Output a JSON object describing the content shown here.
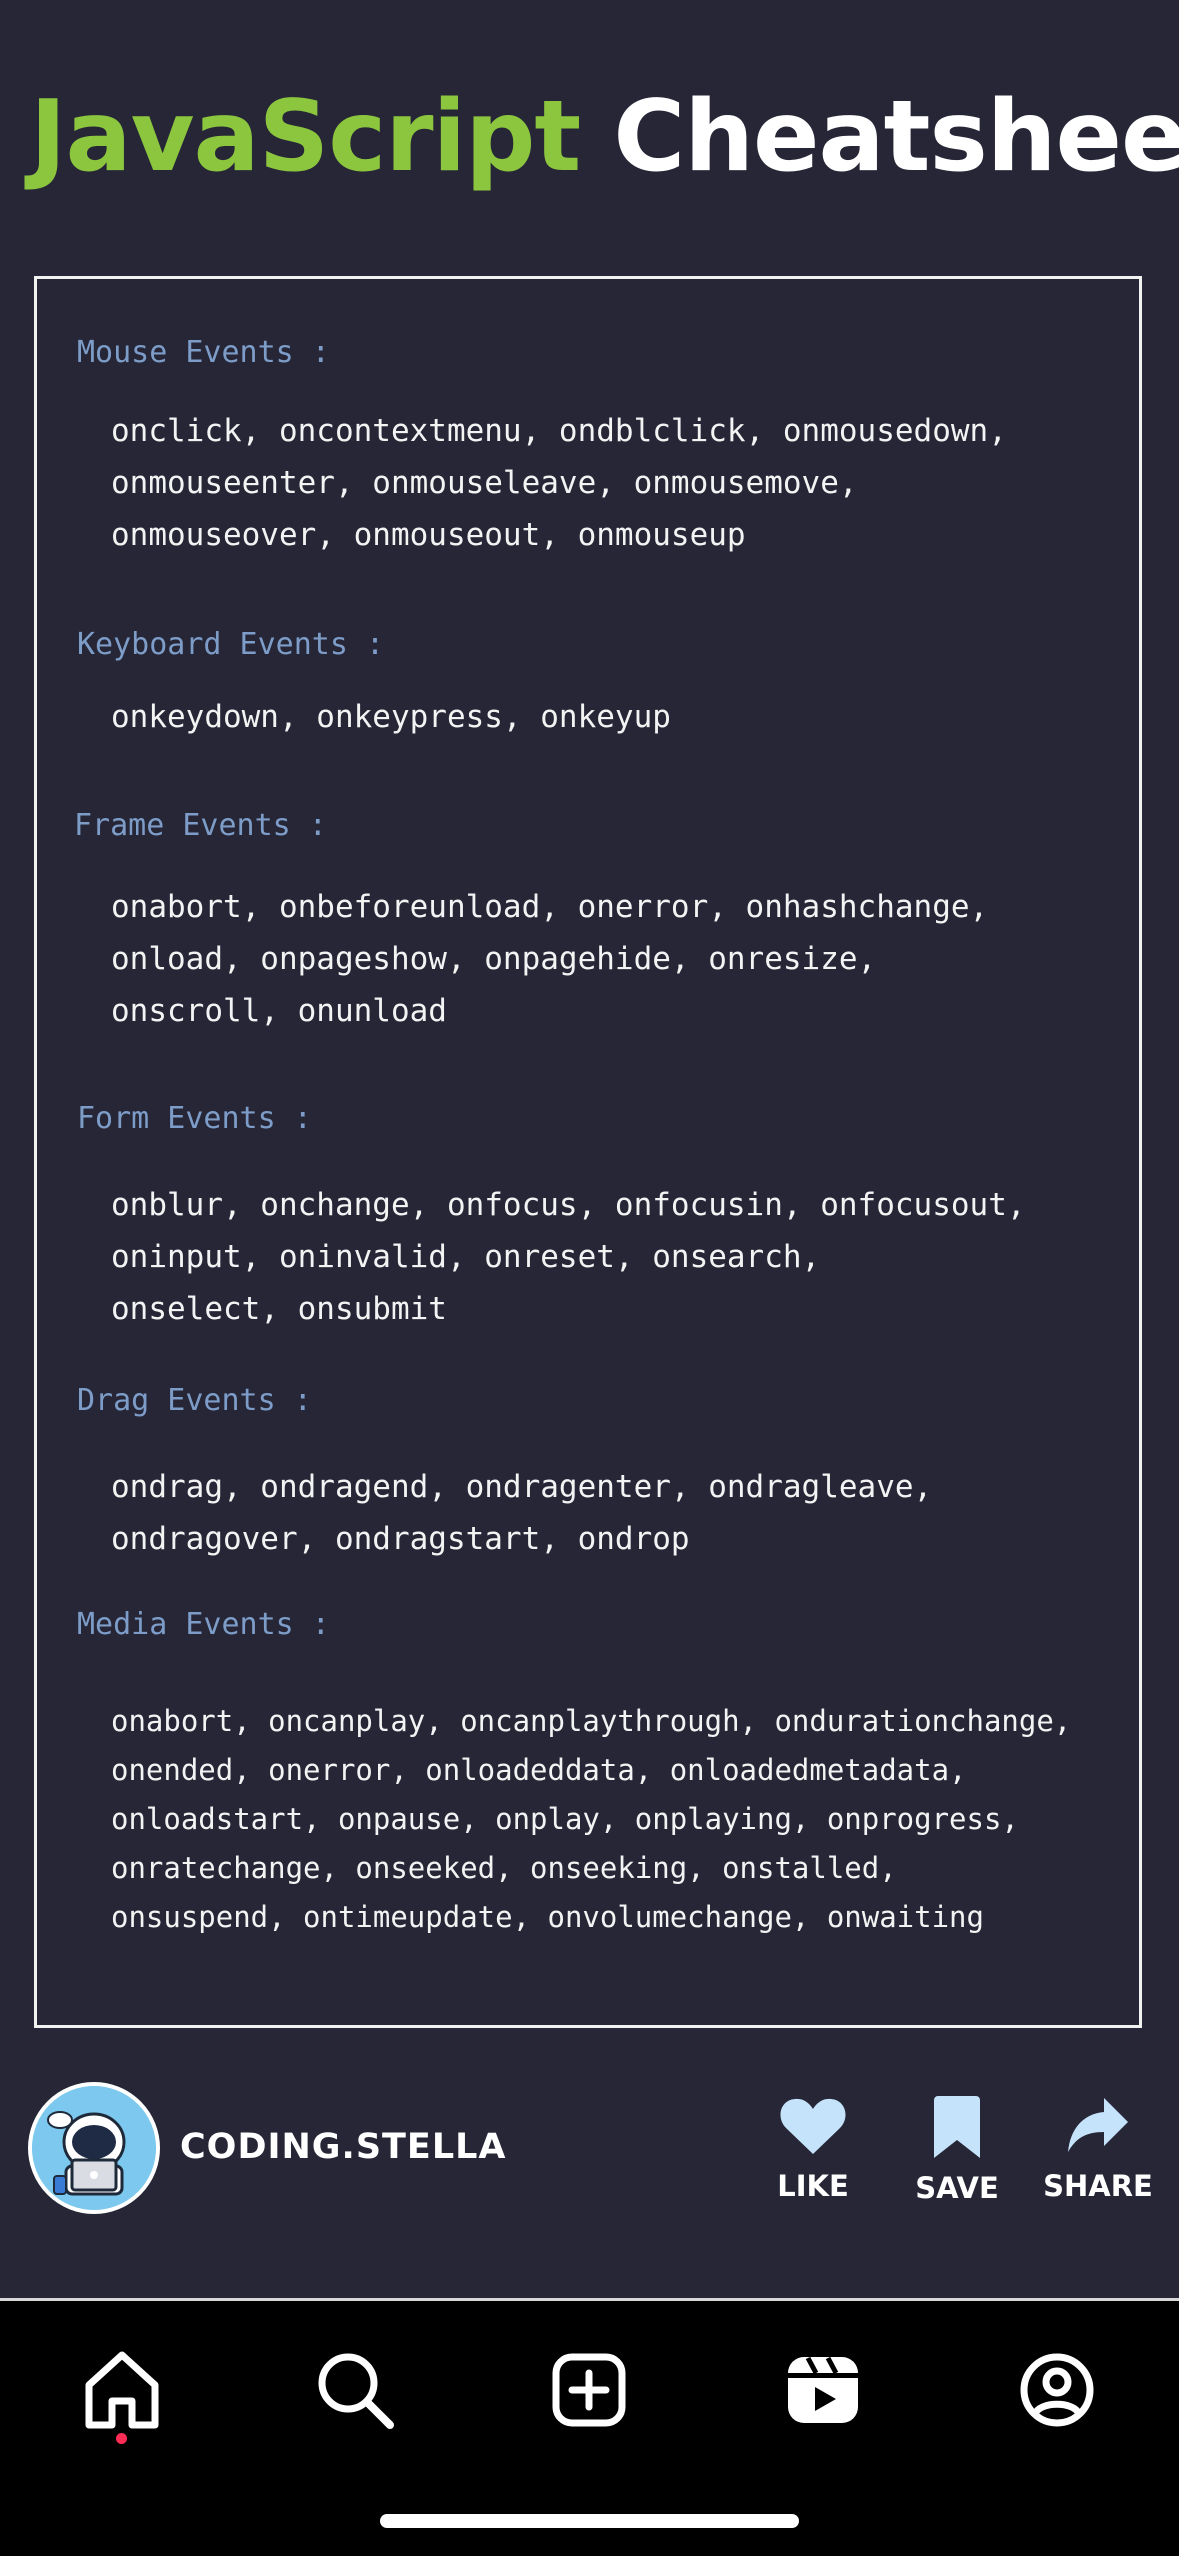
{
  "title": {
    "part1": "JavaScript",
    "part2": "Cheatsheet"
  },
  "sections": [
    {
      "heading": "Mouse Events :",
      "lines": [
        "onclick, oncontextmenu, ondblclick, onmousedown,",
        "onmouseenter, onmouseleave, onmousemove,",
        "onmouseover, onmouseout, onmouseup"
      ]
    },
    {
      "heading": "Keyboard Events :",
      "lines": [
        "onkeydown, onkeypress, onkeyup"
      ]
    },
    {
      "heading": "Frame Events :",
      "lines": [
        "onabort, onbeforeunload, onerror, onhashchange,",
        "onload, onpageshow, onpagehide, onresize,",
        "onscroll, onunload"
      ]
    },
    {
      "heading": "Form Events :",
      "lines": [
        "onblur, onchange, onfocus, onfocusin, onfocusout,",
        "oninput, oninvalid, onreset, onsearch,",
        "onselect, onsubmit"
      ]
    },
    {
      "heading": "Drag Events :",
      "lines": [
        "ondrag, ondragend, ondragenter, ondragleave,",
        "ondragover, ondragstart, ondrop"
      ]
    },
    {
      "heading": "Media Events :",
      "lines": [
        "onabort, oncanplay, oncanplaythrough, ondurationchange,",
        "onended, onerror, onloadeddata, onloadedmetadata,",
        "onloadstart, onpause, onplay, onplaying, onprogress,",
        "onratechange, onseeked, onseeking, onstalled,",
        "onsuspend, ontimeupdate, onvolumechange, onwaiting"
      ]
    }
  ],
  "author": {
    "handle": "CODING.STELLA",
    "avatar_icon": "astronaut-with-laptop-avatar"
  },
  "actions": {
    "like": {
      "label": "LIKE",
      "icon": "heart-icon"
    },
    "save": {
      "label": "SAVE",
      "icon": "bookmark-icon"
    },
    "share": {
      "label": "SHARE",
      "icon": "share-arrow-icon"
    }
  },
  "tabbar": {
    "items": [
      {
        "icon": "home-icon",
        "active": true
      },
      {
        "icon": "search-icon",
        "active": false
      },
      {
        "icon": "create-post-icon",
        "active": false
      },
      {
        "icon": "reels-icon",
        "active": false
      },
      {
        "icon": "profile-icon",
        "active": false
      }
    ]
  },
  "colors": {
    "background": "#262637",
    "title_accent": "#8cc63f",
    "heading": "#7d9dc8",
    "action_icon": "#c5e4fb",
    "notification_dot": "#ff2d55"
  }
}
